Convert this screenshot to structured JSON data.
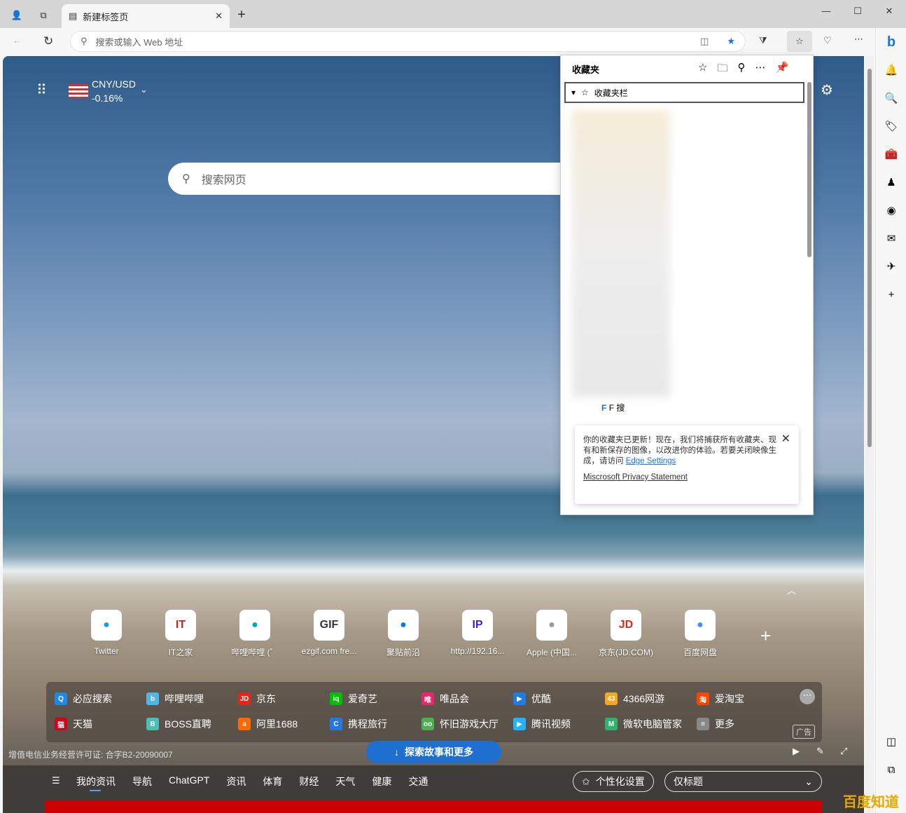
{
  "browser": {
    "tab_title": "新建标签页",
    "address_placeholder": "搜索或输入 Web 地址",
    "window_controls": [
      "minimize",
      "maximize",
      "close"
    ]
  },
  "newtab": {
    "currency": {
      "pair": "CNY/USD",
      "change": "-0.16%"
    },
    "search_placeholder": "搜索网页",
    "tiles": [
      {
        "label": "Twitter",
        "icon": "twitter",
        "color": "#1d9bf0"
      },
      {
        "label": "IT之家",
        "icon": "IT",
        "color": "#d71920"
      },
      {
        "label": "哔哩哔哩 (゜",
        "icon": "bilibili",
        "color": "#00a1d6"
      },
      {
        "label": "ezgif.com fre...",
        "icon": "GIF",
        "color": "#334"
      },
      {
        "label": "聚贴前沿",
        "icon": "edge",
        "color": "#0a7ed6"
      },
      {
        "label": "http://192.16...",
        "icon": "IP",
        "color": "#3b1fd6"
      },
      {
        "label": "Apple (中国...",
        "icon": "apple",
        "color": "#999"
      },
      {
        "label": "京东(JD.COM)",
        "icon": "JD",
        "color": "#e1251b"
      },
      {
        "label": "百度网盘",
        "icon": "baidu-pan",
        "color": "#4e8bff"
      }
    ],
    "quick_links": [
      {
        "label": "必应搜索",
        "color": "#1e88e5",
        "mark": "Q"
      },
      {
        "label": "哔哩哔哩",
        "color": "#4fb6e8",
        "mark": "b"
      },
      {
        "label": "京东",
        "color": "#e1251b",
        "mark": "JD"
      },
      {
        "label": "爱奇艺",
        "color": "#00be06",
        "mark": "iq"
      },
      {
        "label": "唯品会",
        "color": "#e5286a",
        "mark": "唯"
      },
      {
        "label": "优酷",
        "color": "#1f7ce0",
        "mark": "▶"
      },
      {
        "label": "4366网游",
        "color": "#f5a623",
        "mark": "43"
      },
      {
        "label": "爱淘宝",
        "color": "#ff4400",
        "mark": "淘"
      },
      {
        "label": "天猫",
        "color": "#d0021b",
        "mark": "猫"
      },
      {
        "label": "BOSS直聘",
        "color": "#49c0b6",
        "mark": "B"
      },
      {
        "label": "阿里1688",
        "color": "#ff6a00",
        "mark": "a"
      },
      {
        "label": "携程旅行",
        "color": "#2577e3",
        "mark": "C"
      },
      {
        "label": "怀旧游戏大厅",
        "color": "#4caf50",
        "mark": "oo"
      },
      {
        "label": "腾讯视频",
        "color": "#20b4ff",
        "mark": "▶"
      },
      {
        "label": "微软电脑管家",
        "color": "#2db36b",
        "mark": "M"
      },
      {
        "label": "更多",
        "color": "#888",
        "mark": "≡"
      }
    ],
    "ad_label": "广告",
    "license": "增值电信业务经营许可证: 合字B2-20090007",
    "explore_button": "探索故事和更多",
    "news_nav": [
      "我的资讯",
      "导航",
      "ChatGPT",
      "资讯",
      "体育",
      "财经",
      "天气",
      "健康",
      "交通"
    ],
    "personalize": "个性化设置",
    "view_select": "仅标题"
  },
  "favorites": {
    "title": "收藏夹",
    "folder": "收藏夹栏",
    "item": "F 搜",
    "notice": "你的收藏夹已更新！现在，我们将捕获所有收藏夹、现有和新保存的图像，以改进你的体验。若要关闭映像生成，请访问",
    "settings_link": "Edge Settings",
    "privacy_link": "Miscrosoft Privacy Statement"
  },
  "watermark": "百度知道"
}
